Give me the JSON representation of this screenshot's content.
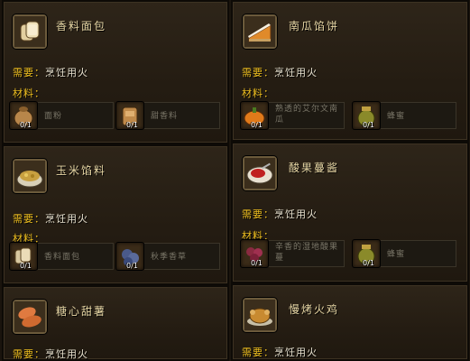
{
  "labels": {
    "requires": "需要：",
    "materials": "材料："
  },
  "recipes": [
    {
      "name": "香料面包",
      "icon": "bread-icon",
      "requirement": "烹饪用火",
      "reagents": [
        {
          "name": "面粉",
          "count": "0/1",
          "icon": "flour-sack-icon"
        },
        {
          "name": "甜香料",
          "count": "0/1",
          "icon": "spice-icon"
        }
      ]
    },
    {
      "name": "南瓜馅饼",
      "icon": "pumpkin-pie-icon",
      "requirement": "烹饪用火",
      "reagents": [
        {
          "name": "熟透的艾尔文南瓜",
          "count": "0/1",
          "icon": "pumpkin-icon"
        },
        {
          "name": "蜂蜜",
          "count": "0/1",
          "icon": "honey-jar-icon"
        }
      ]
    },
    {
      "name": "玉米馅料",
      "icon": "corn-stuffing-icon",
      "requirement": "烹饪用火",
      "reagents": [
        {
          "name": "香料面包",
          "count": "0/1",
          "icon": "bread-icon"
        },
        {
          "name": "秋季香草",
          "count": "0/1",
          "icon": "herb-icon"
        }
      ]
    },
    {
      "name": "酸果蔓酱",
      "icon": "cranberry-sauce-icon",
      "requirement": "烹饪用火",
      "reagents": [
        {
          "name": "辛香的湿地酸果蔓",
          "count": "0/1",
          "icon": "cranberry-icon"
        },
        {
          "name": "蜂蜜",
          "count": "0/1",
          "icon": "honey-jar-icon"
        }
      ]
    },
    {
      "name": "糖心甜薯",
      "icon": "sweet-potato-icon",
      "requirement": "烹饪用火",
      "reagents": []
    },
    {
      "name": "慢烤火鸡",
      "icon": "roast-turkey-icon",
      "requirement": "烹饪用火",
      "reagents": []
    }
  ],
  "colors": {
    "title": "#e9d8a6",
    "label_gold": "#f0c020",
    "reagent_text": "#7a7668"
  }
}
